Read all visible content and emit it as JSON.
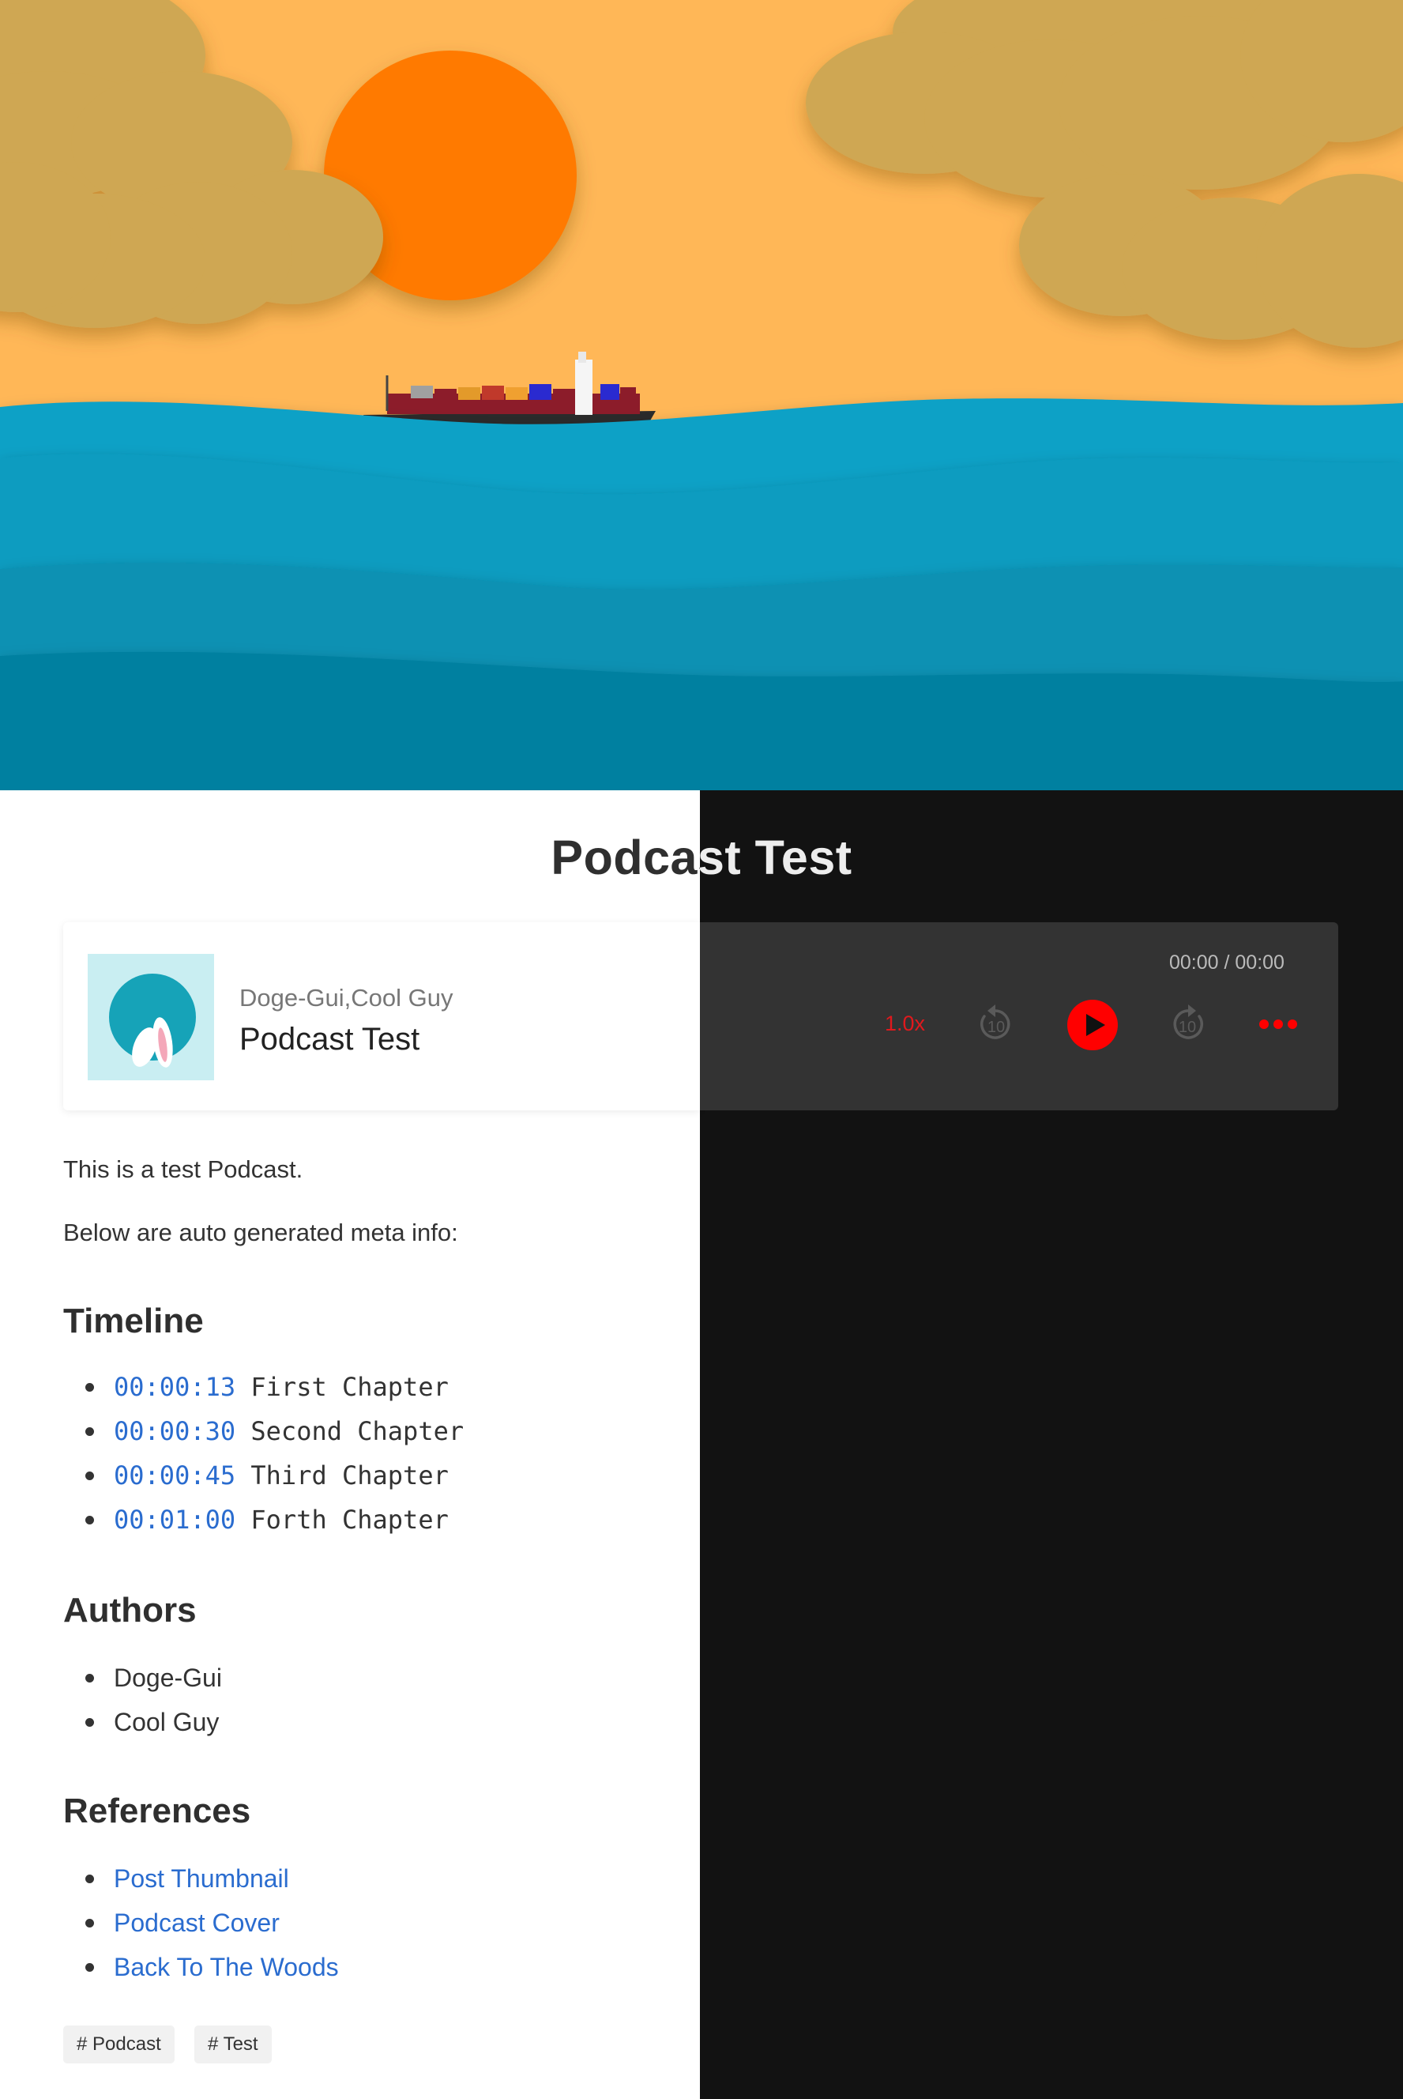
{
  "header": {
    "title": "Podcast Test"
  },
  "player": {
    "authors": "Doge-Gui,Cool Guy",
    "name": "Podcast Test",
    "time": "00:00 / 00:00",
    "speed": "1.0x",
    "skip_back_label": "10",
    "skip_forward_label": "10",
    "accent_color": "#ff0000"
  },
  "content": {
    "intro": "This is a test Podcast.",
    "meta_intro": "Below are auto generated meta info:",
    "timeline": {
      "heading": "Timeline",
      "items": [
        {
          "time": "00:00:13",
          "label": "First Chapter"
        },
        {
          "time": "00:00:30",
          "label": "Second Chapter"
        },
        {
          "time": "00:00:45",
          "label": "Third Chapter"
        },
        {
          "time": "00:01:00",
          "label": "Forth Chapter"
        }
      ]
    },
    "authors": {
      "heading": "Authors",
      "items": [
        "Doge-Gui",
        "Cool Guy"
      ]
    },
    "references": {
      "heading": "References",
      "items": [
        "Post Thumbnail",
        "Podcast Cover",
        "Back To The Woods"
      ]
    },
    "tags": [
      "# Podcast",
      "# Test"
    ]
  }
}
